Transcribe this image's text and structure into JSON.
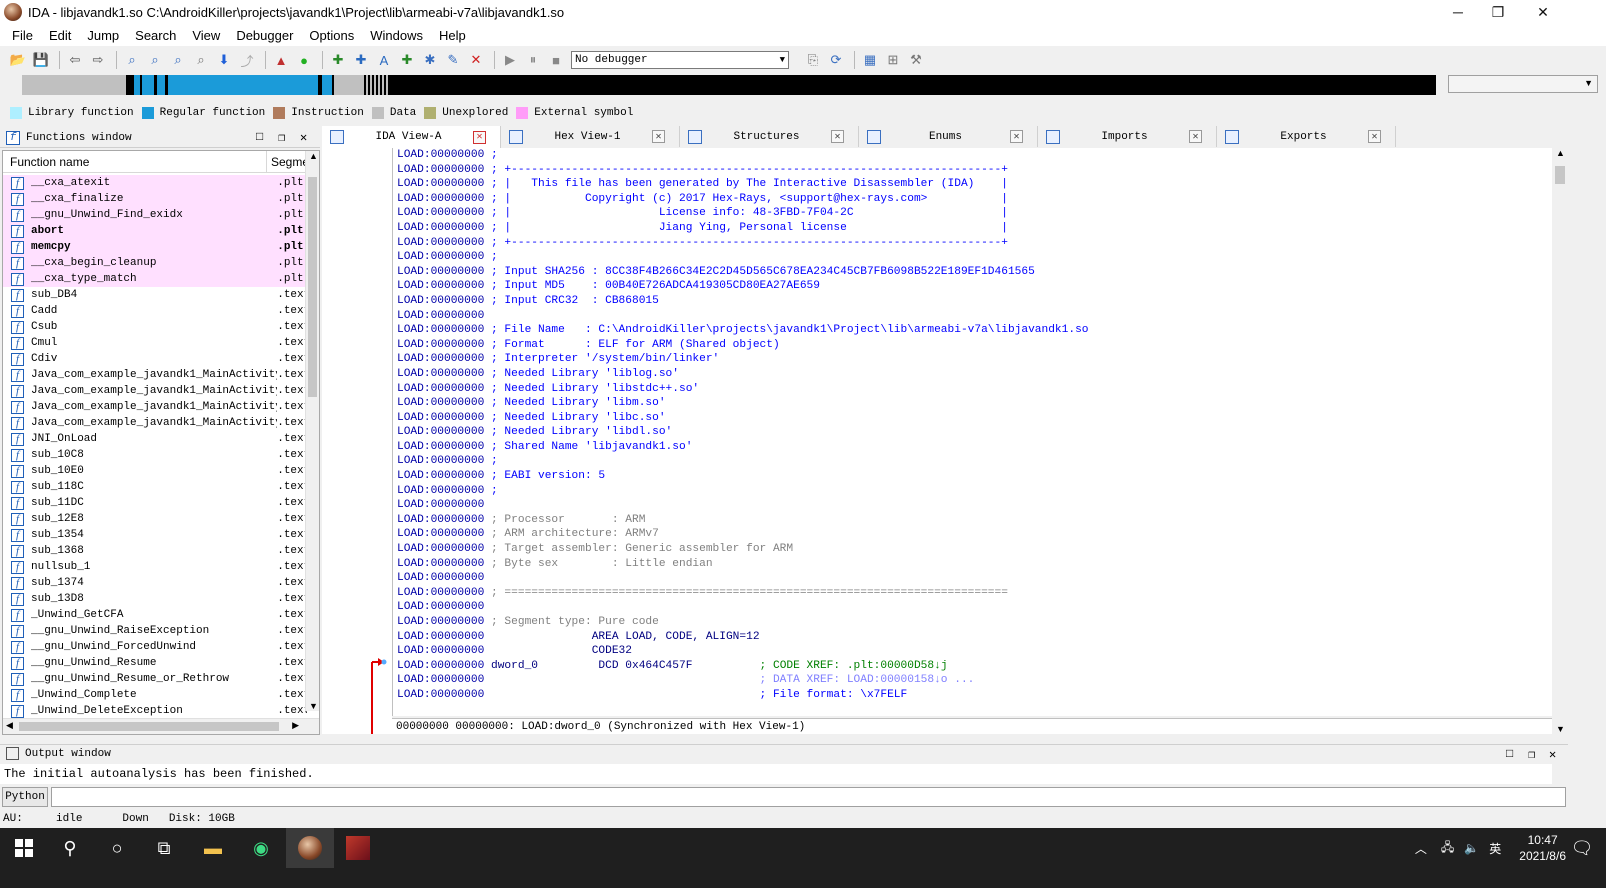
{
  "window": {
    "title": "IDA - libjavandk1.so C:\\AndroidKiller\\projects\\javandk1\\Project\\lib\\armeabi-v7a\\libjavandk1.so",
    "minimize": "─",
    "maximize": "❐",
    "close": "✕"
  },
  "menu": [
    "File",
    "Edit",
    "Jump",
    "Search",
    "View",
    "Debugger",
    "Options",
    "Windows",
    "Help"
  ],
  "toolbar": {
    "debugger": "No debugger"
  },
  "legend": [
    {
      "label": "Library function",
      "color": "#aeefff"
    },
    {
      "label": "Regular function",
      "color": "#1b9bd9"
    },
    {
      "label": "Instruction",
      "color": "#b07b5c"
    },
    {
      "label": "Data",
      "color": "#c0c0c0"
    },
    {
      "label": "Unexplored",
      "color": "#b0b070"
    },
    {
      "label": "External symbol",
      "color": "#ff9cf8"
    }
  ],
  "functions_window": {
    "title": "Functions window",
    "col_name": "Function name",
    "col_seg": "Segment",
    "rows": [
      {
        "name": "__cxa_atexit",
        "seg": ".plt",
        "pink": true,
        "bold": false
      },
      {
        "name": "__cxa_finalize",
        "seg": ".plt",
        "pink": true,
        "bold": false
      },
      {
        "name": "__gnu_Unwind_Find_exidx",
        "seg": ".plt",
        "pink": true,
        "bold": false
      },
      {
        "name": "abort",
        "seg": ".plt",
        "pink": true,
        "bold": true
      },
      {
        "name": "memcpy",
        "seg": ".plt",
        "pink": true,
        "bold": true
      },
      {
        "name": "__cxa_begin_cleanup",
        "seg": ".plt",
        "pink": true,
        "bold": false
      },
      {
        "name": "__cxa_type_match",
        "seg": ".plt",
        "pink": true,
        "bold": false
      },
      {
        "name": "sub_DB4",
        "seg": ".text",
        "pink": false,
        "bold": false
      },
      {
        "name": "Cadd",
        "seg": ".text",
        "pink": false,
        "bold": false
      },
      {
        "name": "Csub",
        "seg": ".text",
        "pink": false,
        "bold": false
      },
      {
        "name": "Cmul",
        "seg": ".text",
        "pink": false,
        "bold": false
      },
      {
        "name": "Cdiv",
        "seg": ".text",
        "pink": false,
        "bold": false
      },
      {
        "name": "Java_com_example_javandk1_MainActivity…",
        "seg": ".text",
        "pink": false,
        "bold": false
      },
      {
        "name": "Java_com_example_javandk1_MainActivity…",
        "seg": ".text",
        "pink": false,
        "bold": false
      },
      {
        "name": "Java_com_example_javandk1_MainActivity…",
        "seg": ".text",
        "pink": false,
        "bold": false
      },
      {
        "name": "Java_com_example_javandk1_MainActivity…",
        "seg": ".text",
        "pink": false,
        "bold": false
      },
      {
        "name": "JNI_OnLoad",
        "seg": ".text",
        "pink": false,
        "bold": false
      },
      {
        "name": "sub_10C8",
        "seg": ".text",
        "pink": false,
        "bold": false
      },
      {
        "name": "sub_10E0",
        "seg": ".text",
        "pink": false,
        "bold": false
      },
      {
        "name": "sub_118C",
        "seg": ".text",
        "pink": false,
        "bold": false
      },
      {
        "name": "sub_11DC",
        "seg": ".text",
        "pink": false,
        "bold": false
      },
      {
        "name": "sub_12E8",
        "seg": ".text",
        "pink": false,
        "bold": false
      },
      {
        "name": "sub_1354",
        "seg": ".text",
        "pink": false,
        "bold": false
      },
      {
        "name": "sub_1368",
        "seg": ".text",
        "pink": false,
        "bold": false
      },
      {
        "name": "nullsub_1",
        "seg": ".text",
        "pink": false,
        "bold": false
      },
      {
        "name": "sub_1374",
        "seg": ".text",
        "pink": false,
        "bold": false
      },
      {
        "name": "sub_13D8",
        "seg": ".text",
        "pink": false,
        "bold": false
      },
      {
        "name": "_Unwind_GetCFA",
        "seg": ".text",
        "pink": false,
        "bold": false
      },
      {
        "name": "__gnu_Unwind_RaiseException",
        "seg": ".text",
        "pink": false,
        "bold": false
      },
      {
        "name": "__gnu_Unwind_ForcedUnwind",
        "seg": ".text",
        "pink": false,
        "bold": false
      },
      {
        "name": "__gnu_Unwind_Resume",
        "seg": ".text",
        "pink": false,
        "bold": false
      },
      {
        "name": "__gnu_Unwind_Resume_or_Rethrow",
        "seg": ".text",
        "pink": false,
        "bold": false
      },
      {
        "name": "_Unwind_Complete",
        "seg": ".text",
        "pink": false,
        "bold": false
      },
      {
        "name": "_Unwind_DeleteException",
        "seg": ".text",
        "pink": false,
        "bold": false
      }
    ]
  },
  "tabs": [
    {
      "label": "IDA View-A",
      "active": true
    },
    {
      "label": "Hex View-1",
      "active": false
    },
    {
      "label": "Structures",
      "active": false
    },
    {
      "label": "Enums",
      "active": false
    },
    {
      "label": "Imports",
      "active": false
    },
    {
      "label": "Exports",
      "active": false
    }
  ],
  "disassembly": [
    {
      "a": "LOAD:00000000",
      "t": " ;",
      "c": "cm"
    },
    {
      "a": "LOAD:00000000",
      "t": " ; +-------------------------------------------------------------------------+",
      "c": "cm"
    },
    {
      "a": "LOAD:00000000",
      "t": " ; |   This file has been generated by The Interactive Disassembler (IDA)    |",
      "c": "cm"
    },
    {
      "a": "LOAD:00000000",
      "t": " ; |           Copyright (c) 2017 Hex-Rays, <support@hex-rays.com>           |",
      "c": "cm"
    },
    {
      "a": "LOAD:00000000",
      "t": " ; |                      License info: 48-3FBD-7F04-2C                      |",
      "c": "cm"
    },
    {
      "a": "LOAD:00000000",
      "t": " ; |                      Jiang Ying, Personal license                       |",
      "c": "cm"
    },
    {
      "a": "LOAD:00000000",
      "t": " ; +-------------------------------------------------------------------------+",
      "c": "cm"
    },
    {
      "a": "LOAD:00000000",
      "t": " ;",
      "c": "cm"
    },
    {
      "a": "LOAD:00000000",
      "t": " ; Input SHA256 : 8CC38F4B266C34E2C2D45D565C678EA234C45CB7FB6098B522E189EF1D461565",
      "c": "cm"
    },
    {
      "a": "LOAD:00000000",
      "t": " ; Input MD5    : 00B40E726ADCA419305CD80EA27AE659",
      "c": "cm"
    },
    {
      "a": "LOAD:00000000",
      "t": " ; Input CRC32  : CB868015",
      "c": "cm"
    },
    {
      "a": "LOAD:00000000",
      "t": "",
      "c": "cm"
    },
    {
      "a": "LOAD:00000000",
      "t": " ; File Name   : C:\\AndroidKiller\\projects\\javandk1\\Project\\lib\\armeabi-v7a\\libjavandk1.so",
      "c": "cm"
    },
    {
      "a": "LOAD:00000000",
      "t": " ; Format      : ELF for ARM (Shared object)",
      "c": "cm"
    },
    {
      "a": "LOAD:00000000",
      "t": " ; Interpreter '/system/bin/linker'",
      "c": "cm"
    },
    {
      "a": "LOAD:00000000",
      "t": " ; Needed Library 'liblog.so'",
      "c": "cm"
    },
    {
      "a": "LOAD:00000000",
      "t": " ; Needed Library 'libstdc++.so'",
      "c": "cm"
    },
    {
      "a": "LOAD:00000000",
      "t": " ; Needed Library 'libm.so'",
      "c": "cm"
    },
    {
      "a": "LOAD:00000000",
      "t": " ; Needed Library 'libc.so'",
      "c": "cm"
    },
    {
      "a": "LOAD:00000000",
      "t": " ; Needed Library 'libdl.so'",
      "c": "cm"
    },
    {
      "a": "LOAD:00000000",
      "t": " ; Shared Name 'libjavandk1.so'",
      "c": "cm"
    },
    {
      "a": "LOAD:00000000",
      "t": " ;",
      "c": "cm"
    },
    {
      "a": "LOAD:00000000",
      "t": " ; EABI version: 5",
      "c": "cm"
    },
    {
      "a": "LOAD:00000000",
      "t": " ;",
      "c": "cm"
    },
    {
      "a": "LOAD:00000000",
      "t": "",
      "c": "cm"
    },
    {
      "a": "LOAD:00000000",
      "t": " ; Processor       : ARM",
      "c": "gc"
    },
    {
      "a": "LOAD:00000000",
      "t": " ; ARM architecture: ARMv7",
      "c": "gc"
    },
    {
      "a": "LOAD:00000000",
      "t": " ; Target assembler: Generic assembler for ARM",
      "c": "gc"
    },
    {
      "a": "LOAD:00000000",
      "t": " ; Byte sex        : Little endian",
      "c": "gc"
    },
    {
      "a": "LOAD:00000000",
      "t": "",
      "c": "gc"
    },
    {
      "a": "LOAD:00000000",
      "t": " ; ===========================================================================",
      "c": "gc"
    },
    {
      "a": "LOAD:00000000",
      "t": "",
      "c": "gc"
    },
    {
      "a": "LOAD:00000000",
      "t": " ; Segment type: Pure code",
      "c": "gc"
    },
    {
      "a": "LOAD:00000000",
      "t": "                AREA LOAD, CODE, ALIGN=12",
      "c": "lb"
    },
    {
      "a": "LOAD:00000000",
      "t": "                CODE32",
      "c": "lb"
    },
    {
      "a": "LOAD:00000000",
      "t": " dword_0         DCD 0x464C457F          ; CODE XREF: .plt:00000D58↓j",
      "c": "mix1"
    },
    {
      "a": "LOAD:00000000",
      "t": "                                         ; DATA XREF: LOAD:00000158↓o ...",
      "c": "lg2"
    },
    {
      "a": "LOAD:00000000",
      "t": "                                         ; File format: \\x7FELF",
      "c": "cm"
    }
  ],
  "dis_status": "00000000 00000000: LOAD:dword_0 (Synchronized with Hex View-1)",
  "output": {
    "title": "Output window",
    "text": "The initial autoanalysis has been finished.",
    "python": "Python"
  },
  "status": {
    "au_label": "AU:",
    "au_value": "idle",
    "dir": "Down",
    "disk": "Disk: 10GB"
  },
  "taskbar": {
    "ime": "英",
    "time": "10:47",
    "date": "2021/8/6"
  }
}
